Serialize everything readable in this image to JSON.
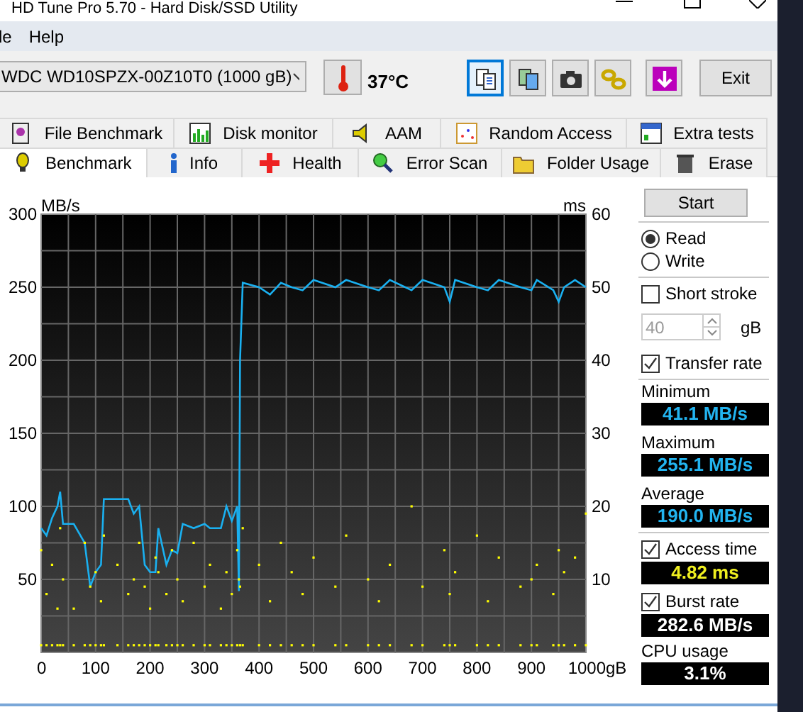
{
  "window": {
    "title": "HD Tune Pro 5.70 - Hard Disk/SSD Utility"
  },
  "menu": [
    "le",
    "Help"
  ],
  "toolbar": {
    "drive": "WDC WD10SPZX-00Z10T0 (1000 gB)",
    "temperature": "37°C",
    "buttons": [
      {
        "selected": true
      },
      {
        "selected": false
      },
      {
        "selected": false
      },
      {
        "selected": false
      },
      {
        "selected": false
      }
    ],
    "exit": "Exit"
  },
  "tabs_top": [
    {
      "label": "File Benchmark",
      "selected": false
    },
    {
      "label": "Disk monitor",
      "selected": false
    },
    {
      "label": "AAM",
      "selected": false
    },
    {
      "label": "Random Access",
      "selected": false
    },
    {
      "label": "Extra tests",
      "selected": false
    }
  ],
  "tabs_bottom": [
    {
      "label": "Benchmark",
      "selected": true
    },
    {
      "label": "Info",
      "selected": false
    },
    {
      "label": "Health",
      "selected": false
    },
    {
      "label": "Error Scan",
      "selected": false
    },
    {
      "label": "Folder Usage",
      "selected": false
    },
    {
      "label": "Erase",
      "selected": false
    }
  ],
  "chart_data": {
    "type": "line",
    "grid": true,
    "ylabel": "MB/s",
    "y2label": "ms",
    "xlim": [
      0,
      1000
    ],
    "ylim": [
      0,
      300
    ],
    "y2lim": [
      0,
      60
    ],
    "xticks": [
      0,
      100,
      200,
      300,
      400,
      500,
      600,
      700,
      800,
      900,
      {
        "value": 1000,
        "label": "1000gB"
      }
    ],
    "yticks": [
      50,
      100,
      150,
      200,
      250,
      300
    ],
    "y2ticks": [
      10,
      20,
      30,
      40,
      50,
      60
    ],
    "x": [
      0,
      10,
      20,
      30,
      35,
      40,
      60,
      80,
      90,
      100,
      110,
      115,
      140,
      160,
      170,
      180,
      190,
      200,
      210,
      215,
      230,
      240,
      250,
      260,
      280,
      300,
      310,
      330,
      340,
      350,
      360,
      363,
      365,
      370,
      400,
      420,
      440,
      460,
      480,
      500,
      540,
      560,
      600,
      620,
      640,
      680,
      700,
      740,
      750,
      760,
      800,
      820,
      840,
      880,
      900,
      910,
      940,
      950,
      960,
      980,
      1000
    ],
    "series": [
      {
        "color": "#1ab0f0",
        "values": [
          85,
          80,
          92,
          100,
          110,
          88,
          88,
          75,
          45,
          55,
          60,
          105,
          105,
          105,
          95,
          100,
          60,
          55,
          55,
          85,
          60,
          70,
          68,
          88,
          85,
          88,
          85,
          85,
          100,
          90,
          100,
          42,
          200,
          253,
          250,
          245,
          253,
          250,
          248,
          255,
          250,
          255,
          250,
          248,
          255,
          248,
          255,
          250,
          240,
          255,
          250,
          248,
          255,
          250,
          248,
          255,
          248,
          240,
          250,
          255,
          250
        ]
      },
      {
        "type": "scatter",
        "axis": "y2",
        "color": "#ffff00",
        "values": [
          14,
          8,
          12,
          6,
          17,
          10,
          6,
          15,
          9,
          11,
          7,
          16,
          12,
          8,
          10,
          15,
          9,
          6,
          13,
          11,
          8,
          14,
          10,
          7,
          15,
          9,
          12,
          6,
          11,
          8,
          14,
          10,
          9,
          17,
          12,
          7,
          15,
          11,
          8,
          13,
          9,
          16,
          10,
          7,
          12,
          20,
          9,
          14,
          8,
          11,
          16,
          7,
          13,
          9,
          10,
          12,
          8,
          14,
          11,
          13,
          19
        ]
      },
      {
        "type": "scatter",
        "axis": "y2",
        "color": "#ffff00",
        "values": [
          1,
          1,
          1,
          1,
          1,
          1,
          1,
          1,
          1,
          1,
          1,
          1,
          1,
          1,
          1,
          1,
          1,
          1,
          1,
          1,
          1,
          1,
          1,
          1,
          1,
          1,
          1,
          1,
          1,
          1,
          1,
          null,
          1,
          1,
          1,
          1,
          1,
          1,
          1,
          1,
          1,
          1,
          1,
          1,
          1,
          1,
          1,
          1,
          1,
          1,
          1,
          1,
          1,
          1,
          1,
          1,
          1,
          1,
          1,
          1,
          1
        ]
      }
    ]
  },
  "panel": {
    "start": "Start",
    "modes": [
      {
        "label": "Read",
        "selected": true
      },
      {
        "label": "Write",
        "selected": false
      }
    ],
    "short_stroke": {
      "label": "Short stroke",
      "checked": false,
      "value": "40",
      "unit": "gB"
    },
    "transfer_rate": {
      "label": "Transfer rate",
      "checked": true
    },
    "stats": [
      {
        "label": "Minimum",
        "value": "41.1 MB/s"
      },
      {
        "label": "Maximum",
        "value": "255.1 MB/s"
      },
      {
        "label": "Average",
        "value": "190.0 MB/s"
      }
    ],
    "access_time": {
      "label": "Access time",
      "checked": true,
      "value": "4.82 ms"
    },
    "burst_rate": {
      "label": "Burst rate",
      "checked": true,
      "value": "282.6 MB/s"
    },
    "cpu": {
      "label": "CPU usage",
      "value": "3.1%"
    }
  }
}
